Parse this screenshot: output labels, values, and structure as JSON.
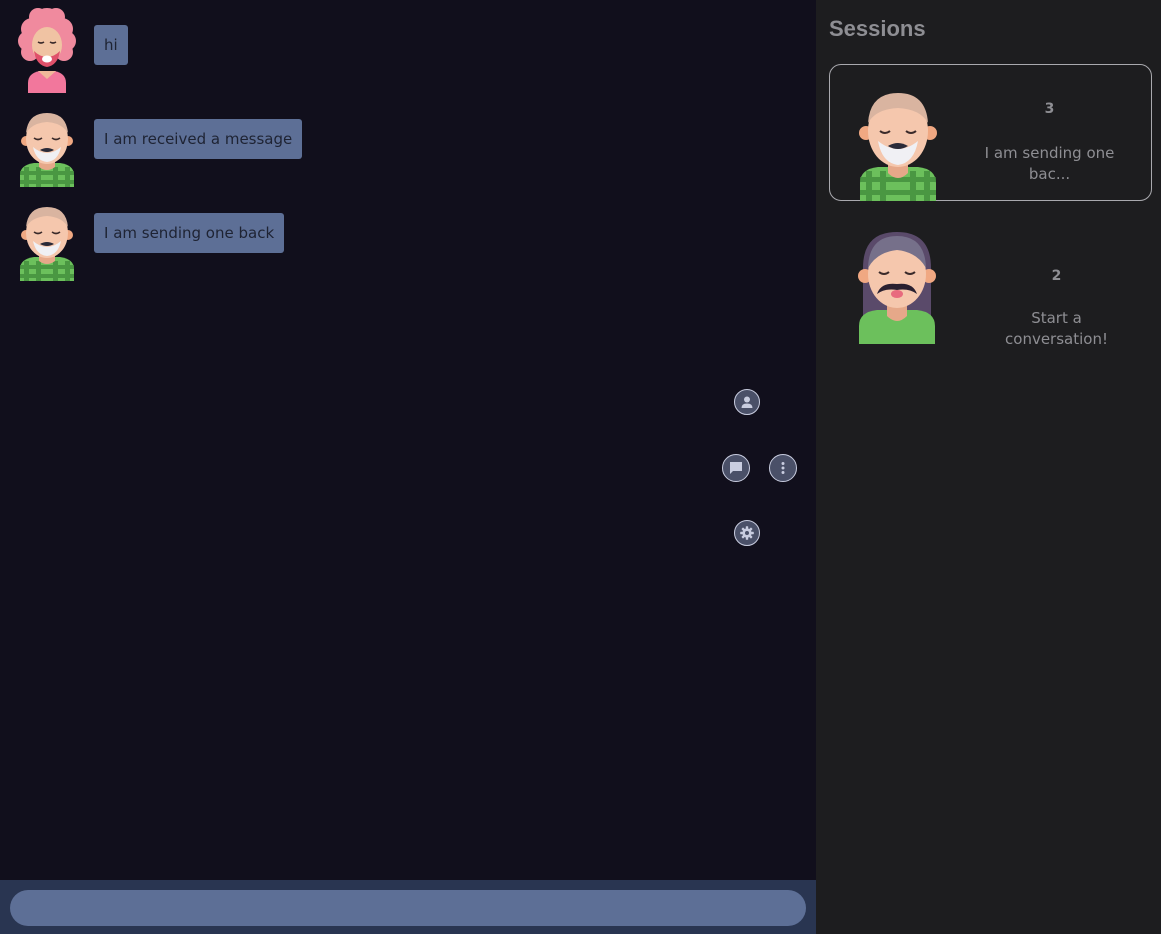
{
  "chat": {
    "messages": [
      {
        "text": "hi",
        "avatar": "curly-haired-avatar"
      },
      {
        "text": "I am received a message",
        "avatar": "bald-bearded-avatar"
      },
      {
        "text": "I am sending one back",
        "avatar": "bald-bearded-avatar"
      }
    ]
  },
  "actions": {
    "profile": "user-icon",
    "chat": "chat-bubble-icon",
    "more": "more-vertical-icon",
    "settings": "gear-icon"
  },
  "composer": {
    "value": "",
    "placeholder": ""
  },
  "sidebar": {
    "title": "Sessions",
    "sessions": [
      {
        "count": "3",
        "preview": "I am sending one bac...",
        "avatar": "bald-bearded-avatar",
        "active": true
      },
      {
        "count": "2",
        "preview": "Start a conversation!",
        "avatar": "mustache-long-hair-avatar",
        "active": false
      }
    ]
  },
  "colors": {
    "chat_background": "#110f1c",
    "bubble": "#5d6f96",
    "composer_bar": "#293551",
    "sidebar_background": "#1d1d1f",
    "sidebar_text": "#8e8e93"
  }
}
